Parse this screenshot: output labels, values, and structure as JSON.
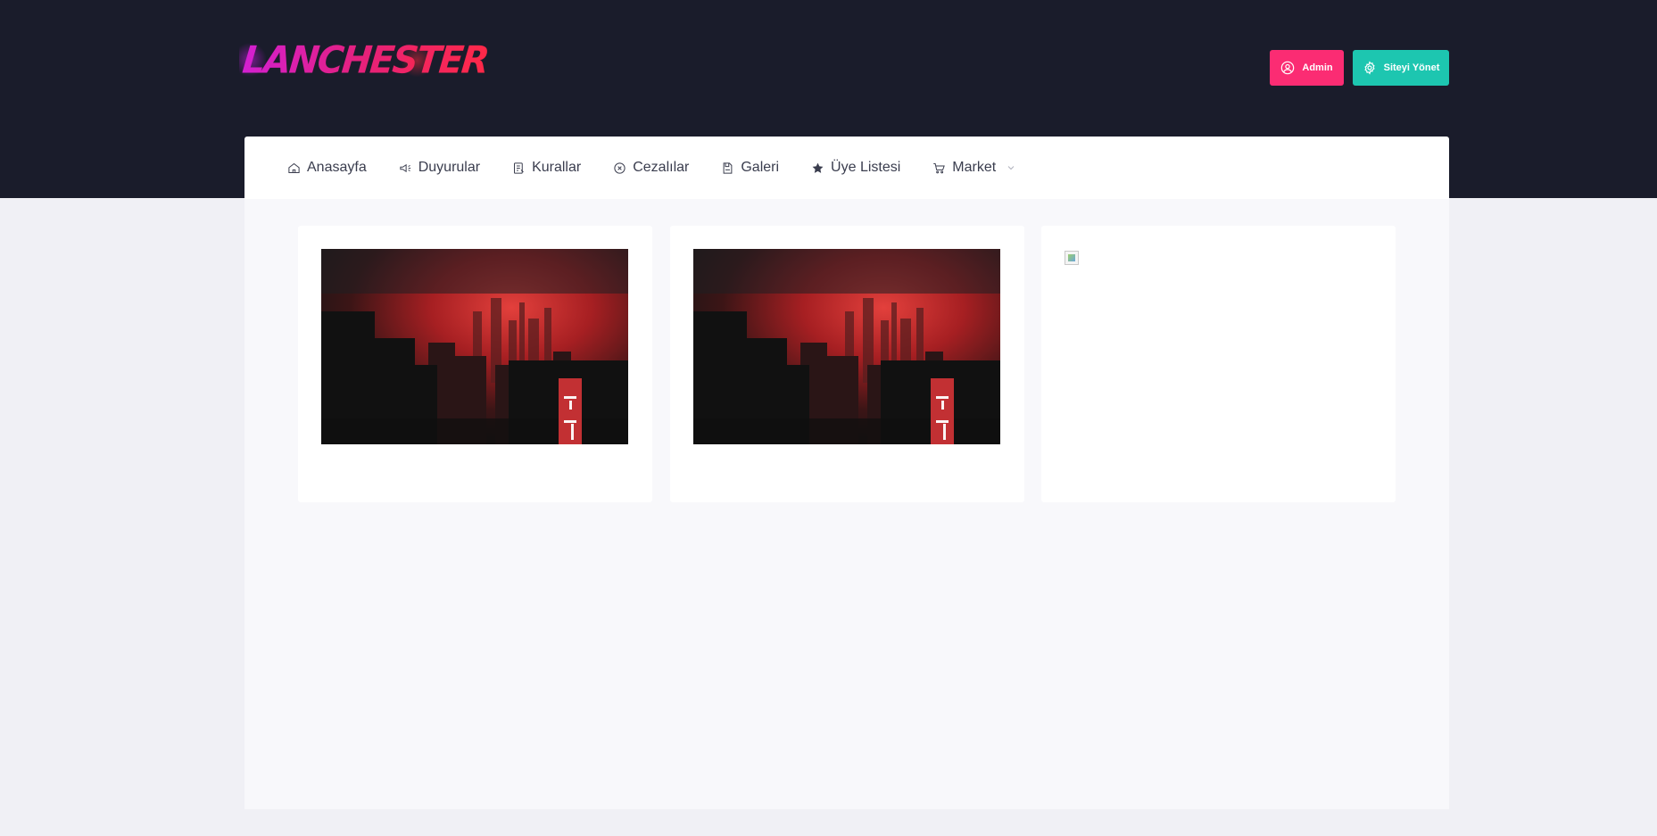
{
  "header": {
    "logo_text": "LANCHESTER",
    "buttons": {
      "admin_label": "Admin",
      "manage_label": "Siteyi Yönet"
    }
  },
  "nav": {
    "items": [
      {
        "label": "Anasayfa",
        "icon": "home-icon"
      },
      {
        "label": "Duyurular",
        "icon": "megaphone-icon"
      },
      {
        "label": "Kurallar",
        "icon": "rules-icon"
      },
      {
        "label": "Cezalılar",
        "icon": "x-circle-icon"
      },
      {
        "label": "Galeri",
        "icon": "gallery-icon"
      },
      {
        "label": "Üye Listesi",
        "icon": "star-icon"
      },
      {
        "label": "Market",
        "icon": "cart-icon",
        "has_dropdown": true
      }
    ]
  },
  "gallery": {
    "cards": [
      {
        "type": "image",
        "subject": "red-sky-city"
      },
      {
        "type": "image",
        "subject": "red-sky-city"
      },
      {
        "type": "broken-image"
      }
    ]
  },
  "colors": {
    "header_bg": "#1a1c2b",
    "admin_btn": "#fb2c73",
    "manage_btn": "#1dc6b0",
    "content_bg": "#f8f8fb",
    "page_bg": "#f0f0f5"
  }
}
